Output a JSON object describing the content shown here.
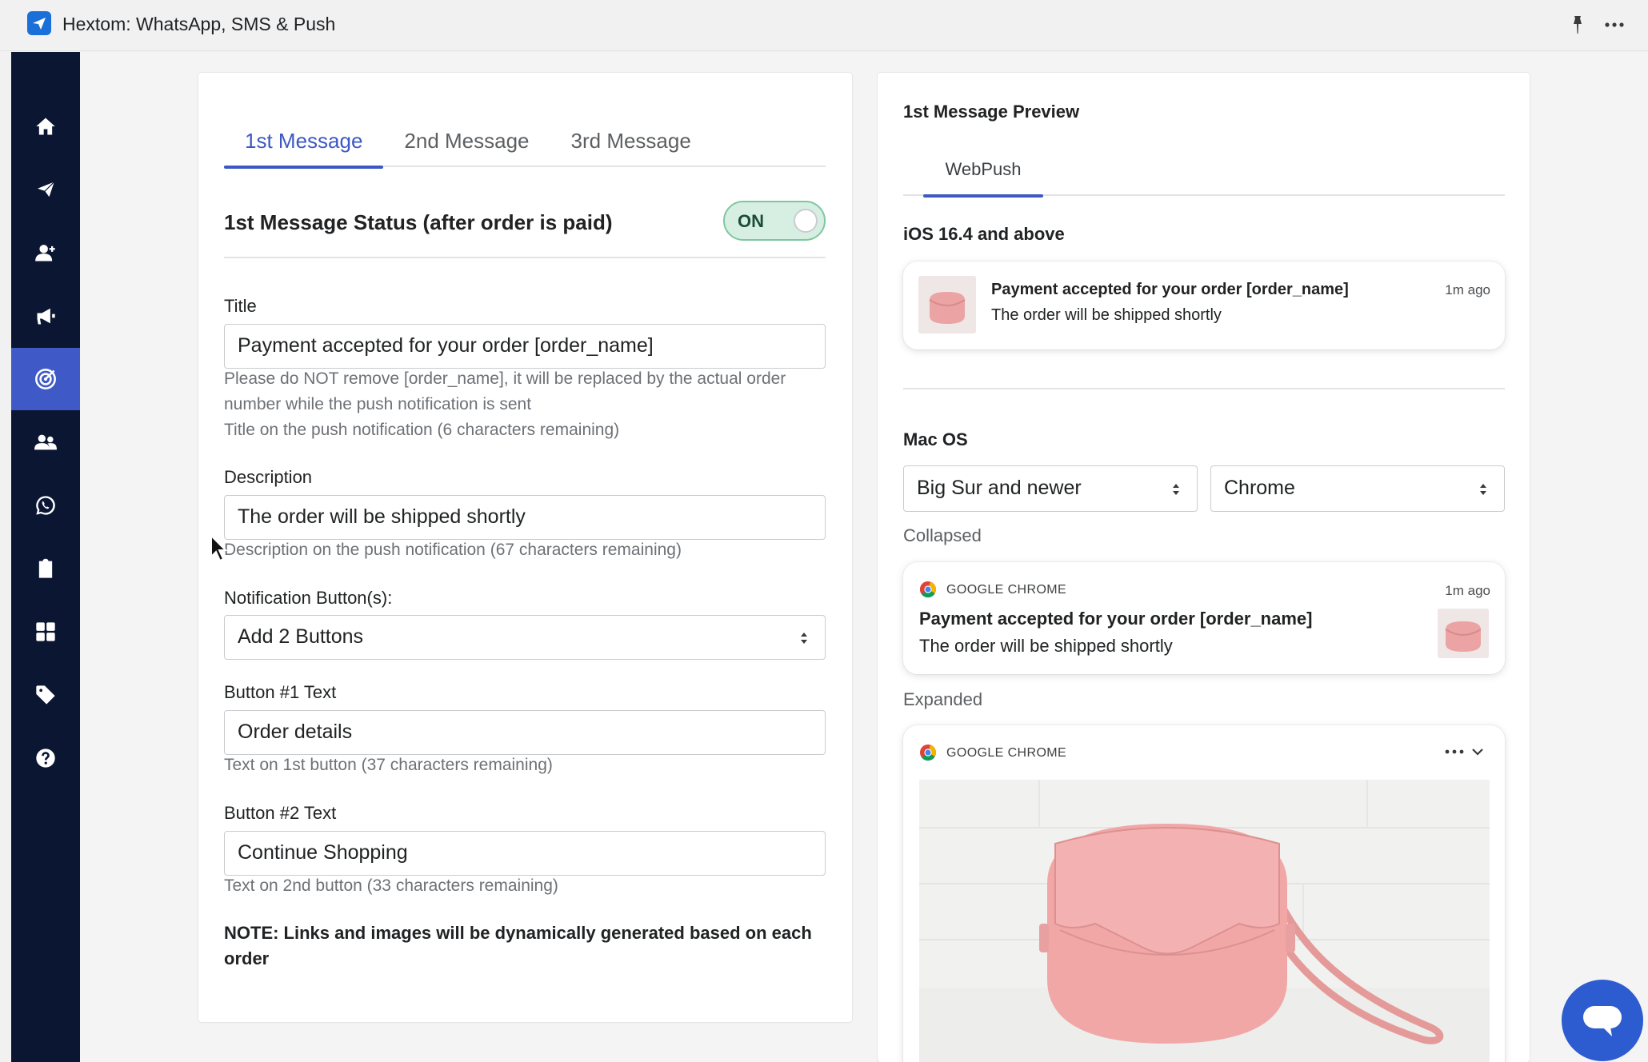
{
  "window": {
    "title": "Hextom: WhatsApp, SMS & Push"
  },
  "sidebar": {
    "items": [
      {
        "name": "home-icon"
      },
      {
        "name": "send-icon"
      },
      {
        "name": "add-user-icon"
      },
      {
        "name": "megaphone-icon"
      },
      {
        "name": "target-icon",
        "active": true
      },
      {
        "name": "users-icon"
      },
      {
        "name": "whatsapp-icon"
      },
      {
        "name": "clipboard-icon"
      },
      {
        "name": "grid-icon"
      },
      {
        "name": "tag-icon"
      },
      {
        "name": "help-icon"
      }
    ]
  },
  "editor": {
    "tabs": [
      "1st Message",
      "2nd Message",
      "3rd Message"
    ],
    "active_tab": 0,
    "status_label": "1st Message Status (after order is paid)",
    "status_toggle": "ON",
    "title_label": "Title",
    "title_value": "Payment accepted for your order [order_name]",
    "title_help_1": "Please do NOT remove [order_name], it will be replaced by the actual order number while the push notification is sent",
    "title_help_2": "Title on the push notification (6 characters remaining)",
    "description_label": "Description",
    "description_value": "The order will be shipped shortly",
    "description_help": "Description on the push notification (67 characters remaining)",
    "buttons_label": "Notification Button(s):",
    "buttons_value": "Add 2 Buttons",
    "button1_label": "Button #1 Text",
    "button1_value": "Order details",
    "button1_help": "Text on 1st button (37 characters remaining)",
    "button2_label": "Button #2 Text",
    "button2_value": "Continue Shopping",
    "button2_help": "Text on 2nd button (33 characters remaining)",
    "note": "NOTE: Links and images will be dynamically generated based on each order"
  },
  "preview": {
    "title": "1st Message Preview",
    "tab": "WebPush",
    "ios_heading": "iOS 16.4 and above",
    "ios_notif": {
      "title": "Payment accepted for your order [order_name]",
      "body": "The order will be shipped shortly",
      "time": "1m ago"
    },
    "mac_heading": "Mac OS",
    "os_select": "Big Sur and newer",
    "browser_select": "Chrome",
    "collapsed_label": "Collapsed",
    "collapsed_notif": {
      "source": "GOOGLE CHROME",
      "time": "1m ago",
      "title": "Payment accepted for your order [order_name]",
      "body": "The order will be shipped shortly"
    },
    "expanded_label": "Expanded",
    "expanded_notif": {
      "source": "GOOGLE CHROME"
    }
  },
  "colors": {
    "accent": "#3c58c4",
    "sidebar_bg": "#0a1632",
    "sidebar_active": "#3f59c7",
    "toggle_bg": "#d7efe2",
    "chat_bubble": "#2d5cd0"
  }
}
